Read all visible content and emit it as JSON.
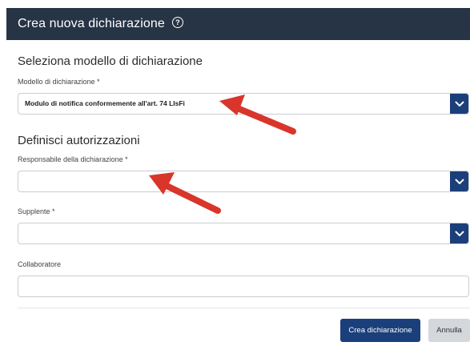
{
  "dialog": {
    "title": "Crea nuova dichiarazione",
    "help_icon": "help-circle-icon"
  },
  "section_model": {
    "title": "Seleziona modello di dichiarazione",
    "field_label": "Modello di dichiarazione *",
    "field_value": "Modulo di notifica conformemente all'art. 74 LIsFi"
  },
  "section_authorizations": {
    "title": "Definisci autorizzazioni",
    "responsabile_label": "Responsabile della dichiarazione *",
    "responsabile_value": "",
    "supplente_label": "Supplente *",
    "supplente_value": "",
    "collaboratore_label": "Collaboratore",
    "collaboratore_value": ""
  },
  "actions": {
    "create_label": "Crea dichiarazione",
    "cancel_label": "Annulla"
  },
  "colors": {
    "header_bg": "#263445",
    "primary": "#1b3f7a",
    "secondary_button": "#d4d7db",
    "annotation_arrow": "#d9352b"
  }
}
